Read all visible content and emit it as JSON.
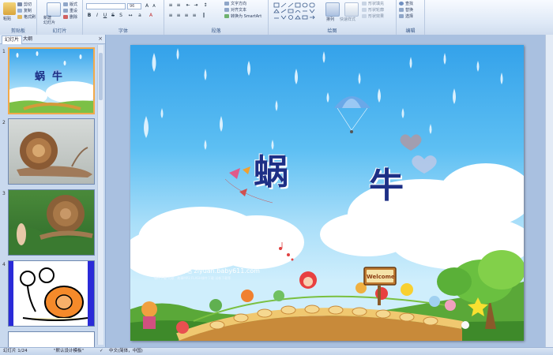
{
  "ribbon": {
    "groups": [
      {
        "name": "clipboard",
        "label": "剪贴板"
      },
      {
        "name": "slides",
        "label": "幻灯片"
      },
      {
        "name": "font",
        "label": "字体"
      },
      {
        "name": "paragraph",
        "label": "段落"
      },
      {
        "name": "drawing",
        "label": "绘图"
      },
      {
        "name": "editing",
        "label": "编辑"
      }
    ],
    "paste_label": "粘贴",
    "clipboard_items": [
      "剪切",
      "复制",
      "格式刷"
    ],
    "new_slide_label": "新建\n幻灯片",
    "slides_items": [
      "版式",
      "重设",
      "删除"
    ],
    "font_size": "96",
    "paragraph_items": [
      "文字方向",
      "对齐文本",
      "转换为 SmartArt"
    ],
    "arrange_label": "排列",
    "quick_styles_label": "快速样式",
    "shape_items": [
      "形状填充",
      "形状轮廓",
      "形状效果"
    ],
    "editing_items": [
      "查找",
      "替换",
      "选择"
    ]
  },
  "left_panel": {
    "tabs": [
      "幻灯片",
      "大纲"
    ],
    "thumbnails": [
      {
        "num": "1",
        "selected": true,
        "title": "蜗  牛"
      },
      {
        "num": "2",
        "selected": false
      },
      {
        "num": "3",
        "selected": false
      },
      {
        "num": "4",
        "selected": false
      }
    ]
  },
  "slide": {
    "title_char_1": "蜗",
    "title_char_2": "牛",
    "sign_text": "Welcome",
    "watermark_main": "幼教资源网站  ziyuan.baby611.com",
    "watermark_sub": "课件下载  儿歌、故事MP3  FLASH课件下载  试卷下载等"
  },
  "status": {
    "slide_info": "幻灯片 1/24",
    "theme": "\"默认设计模板\"",
    "language": "中文(简体，中国)"
  },
  "colors": {
    "accent": "#f2a94a",
    "title": "#1d2f86",
    "sky_top": "#34a2ea"
  }
}
